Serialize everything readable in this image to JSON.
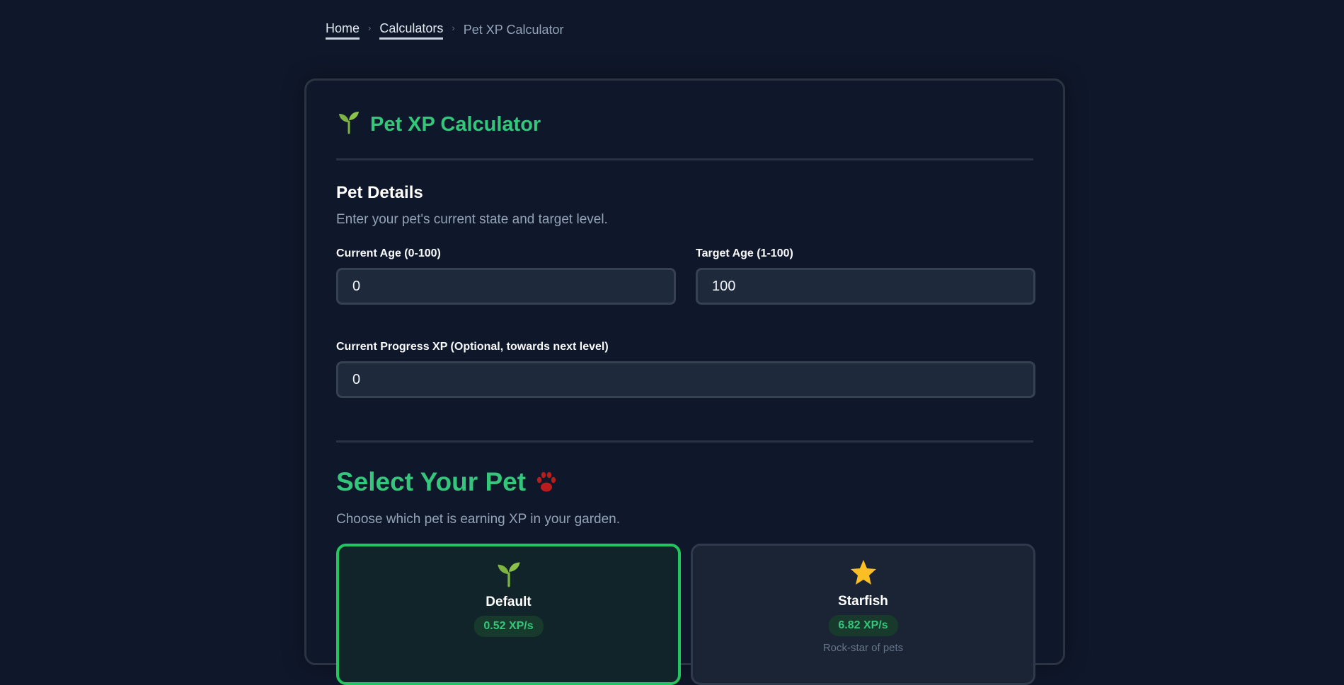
{
  "breadcrumb": {
    "home": "Home",
    "calculators": "Calculators",
    "current": "Pet XP Calculator",
    "separator": "›"
  },
  "header": {
    "title": "Pet XP Calculator",
    "icon": "sprout-icon"
  },
  "pet_details": {
    "title": "Pet Details",
    "description": "Enter your pet's current state and target level.",
    "current_age": {
      "label": "Current Age (0-100)",
      "value": "0"
    },
    "target_age": {
      "label": "Target Age (1-100)",
      "value": "100"
    },
    "current_progress": {
      "label": "Current Progress XP (Optional, towards next level)",
      "value": "0"
    }
  },
  "select_pet": {
    "title": "Select Your Pet",
    "icon": "paw-icon",
    "description": "Choose which pet is earning XP in your garden.",
    "pets": [
      {
        "name": "Default",
        "rate": "0.52 XP/s",
        "icon": "sprout-icon",
        "selected": true,
        "description": ""
      },
      {
        "name": "Starfish",
        "rate": "6.82 XP/s",
        "icon": "star-icon",
        "selected": false,
        "description": "Rock-star of pets"
      }
    ]
  },
  "colors": {
    "background": "#0f172a",
    "accent": "#34c77b",
    "selected_border": "#22c55e",
    "star": "#fbbf24",
    "paw": "#b91c1c"
  }
}
